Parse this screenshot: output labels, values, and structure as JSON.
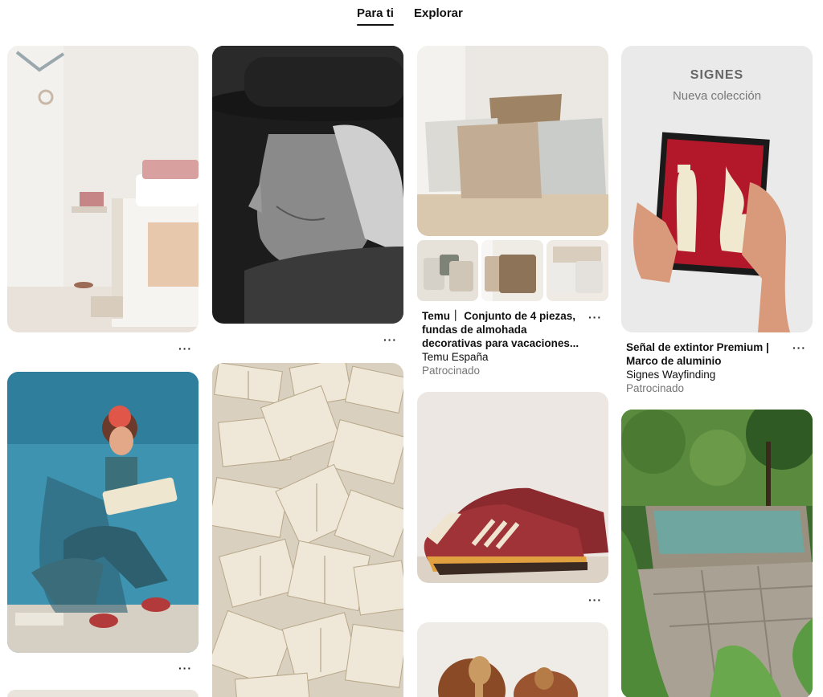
{
  "tabs": {
    "for_you": "Para ti",
    "explore": "Explorar"
  },
  "more_label": "···",
  "pins": {
    "wall_hooks": {
      "icon": "image"
    },
    "elderly_man": {
      "icon": "image"
    },
    "pillows": {
      "title": "Temu｜ Conjunto de 4 piezas, fundas de almohada decorativas para vacaciones...",
      "title_line1": "Temu｜ Conjunto de 4 piezas,",
      "title_line2": "fundas de almohada",
      "title_line3": "decorativas para vacaciones...",
      "advertiser": "Temu España",
      "sponsored": "Patrocinado"
    },
    "signes": {
      "brand": "SIGNES",
      "subtitle": "Nueva colección",
      "title_line1": "Señal de extintor Premium |",
      "title_line2": "Marco de aluminio",
      "advertiser": "Signes Wayfinding",
      "sponsored": "Patrocinado"
    },
    "frida": {
      "icon": "image"
    },
    "books": {
      "icon": "image"
    },
    "sneakers": {
      "icon": "image"
    },
    "pool": {
      "icon": "image"
    },
    "bowls": {
      "icon": "image"
    }
  },
  "colors": {
    "sign_red": "#b3182a",
    "frida_blue": "#3e94b0",
    "sneaker_red": "#8a2a2e",
    "pool_green": "#3d6b2f",
    "text_secondary": "#767676"
  }
}
